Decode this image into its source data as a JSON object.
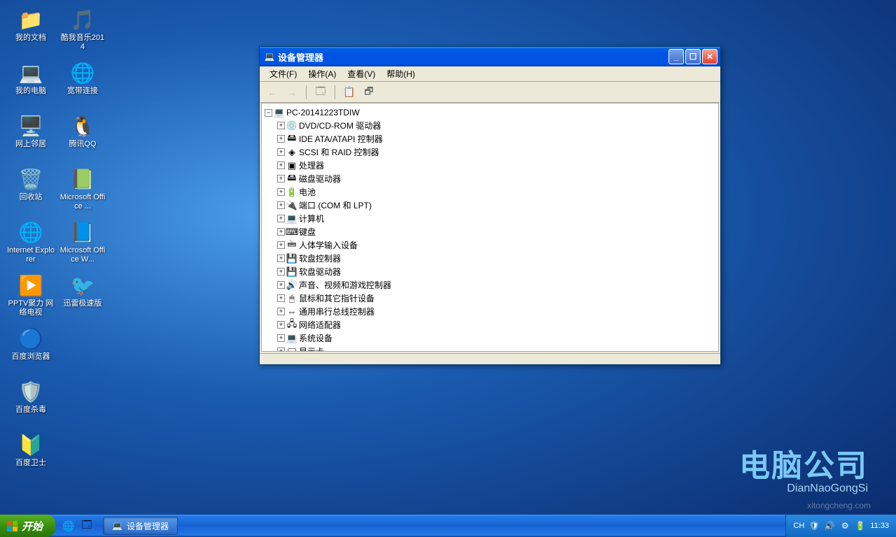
{
  "desktop": {
    "icons": [
      {
        "label": "我的文档",
        "glyph": "📁"
      },
      {
        "label": "酷我音乐2014",
        "glyph": "🎵"
      },
      {
        "label": "我的电脑",
        "glyph": "💻"
      },
      {
        "label": "宽带连接",
        "glyph": "🌐"
      },
      {
        "label": "网上邻居",
        "glyph": "🖥️"
      },
      {
        "label": "腾讯QQ",
        "glyph": "🐧"
      },
      {
        "label": "回收站",
        "glyph": "🗑️"
      },
      {
        "label": "Microsoft Office ...",
        "glyph": "📗"
      },
      {
        "label": "Internet Explorer",
        "glyph": "🌐"
      },
      {
        "label": "Microsoft Office W...",
        "glyph": "📘"
      },
      {
        "label": "PPTV聚力 网络电视",
        "glyph": "▶️"
      },
      {
        "label": "迅雷极速版",
        "glyph": "🐦"
      },
      {
        "label": "百度浏览器",
        "glyph": "🔵"
      },
      {
        "label": "",
        "glyph": ""
      },
      {
        "label": "百度杀毒",
        "glyph": "🛡️"
      },
      {
        "label": "",
        "glyph": ""
      },
      {
        "label": "百度卫士",
        "glyph": "🔰"
      }
    ]
  },
  "brand": {
    "cn": "电脑公司",
    "en": "DianNaoGongSi"
  },
  "watermark": "xitongcheng.com",
  "window": {
    "title": "设备管理器",
    "menu": [
      "文件(F)",
      "操作(A)",
      "查看(V)",
      "帮助(H)"
    ],
    "tree": {
      "root": "PC-20141223TDIW",
      "children": [
        {
          "label": "DVD/CD-ROM 驱动器",
          "icon": "💿"
        },
        {
          "label": "IDE ATA/ATAPI 控制器",
          "icon": "🖴"
        },
        {
          "label": "SCSI 和 RAID 控制器",
          "icon": "◈"
        },
        {
          "label": "处理器",
          "icon": "▣"
        },
        {
          "label": "磁盘驱动器",
          "icon": "🖴"
        },
        {
          "label": "电池",
          "icon": "🔋"
        },
        {
          "label": "端口 (COM 和 LPT)",
          "icon": "🔌"
        },
        {
          "label": "计算机",
          "icon": "💻"
        },
        {
          "label": "键盘",
          "icon": "⌨"
        },
        {
          "label": "人体学输入设备",
          "icon": "🖮"
        },
        {
          "label": "软盘控制器",
          "icon": "💾"
        },
        {
          "label": "软盘驱动器",
          "icon": "💾"
        },
        {
          "label": "声音、视频和游戏控制器",
          "icon": "🔊"
        },
        {
          "label": "鼠标和其它指针设备",
          "icon": "🖱"
        },
        {
          "label": "通用串行总线控制器",
          "icon": "⇔"
        },
        {
          "label": "网络适配器",
          "icon": "🖧"
        },
        {
          "label": "系统设备",
          "icon": "💻"
        },
        {
          "label": "显示卡",
          "icon": "🖵"
        }
      ]
    }
  },
  "taskbar": {
    "start": "开始",
    "task": "设备管理器",
    "lang": "CH",
    "time": "11:33"
  }
}
